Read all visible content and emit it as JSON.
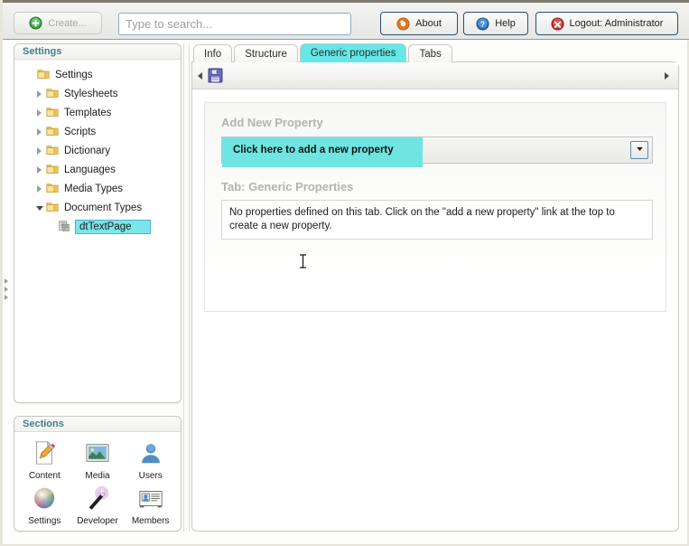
{
  "header": {
    "create_label": "Create...",
    "search_placeholder": "Type to search...",
    "search_value": "",
    "about_label": "About",
    "help_label": "Help",
    "logout_label": "Logout: Administrator",
    "icons": {
      "create": "green-plus-circle-icon",
      "about": "orange-refresh-circle-icon",
      "help": "blue-question-circle-icon",
      "logout": "red-x-circle-icon"
    }
  },
  "sidebar": {
    "tree_panel_title": "Settings",
    "tree": [
      {
        "label": "Settings",
        "level": 1,
        "state": "root",
        "icon": "folder-icon"
      },
      {
        "label": "Stylesheets",
        "level": 2,
        "state": "collapsed",
        "icon": "folder-icon"
      },
      {
        "label": "Templates",
        "level": 2,
        "state": "collapsed",
        "icon": "folder-icon"
      },
      {
        "label": "Scripts",
        "level": 2,
        "state": "collapsed",
        "icon": "folder-icon"
      },
      {
        "label": "Dictionary",
        "level": 2,
        "state": "collapsed",
        "icon": "folder-icon"
      },
      {
        "label": "Languages",
        "level": 2,
        "state": "collapsed",
        "icon": "folder-icon"
      },
      {
        "label": "Media Types",
        "level": 2,
        "state": "collapsed",
        "icon": "folder-icon"
      },
      {
        "label": "Document Types",
        "level": 2,
        "state": "expanded",
        "icon": "folder-icon"
      },
      {
        "label": "dtTextPage",
        "level": 3,
        "state": "selected",
        "icon": "document-type-icon"
      }
    ],
    "sections_panel_title": "Sections",
    "sections": [
      {
        "label": "Content",
        "icon": "page-pencil-icon"
      },
      {
        "label": "Media",
        "icon": "picture-frame-icon"
      },
      {
        "label": "Users",
        "icon": "user-silhouette-icon"
      },
      {
        "label": "Settings",
        "icon": "color-sphere-icon"
      },
      {
        "label": "Developer",
        "icon": "magic-wand-icon"
      },
      {
        "label": "Members",
        "icon": "member-card-icon"
      }
    ]
  },
  "main": {
    "tabs": [
      {
        "label": "Info",
        "active": false
      },
      {
        "label": "Structure",
        "active": false
      },
      {
        "label": "Generic properties",
        "active": true
      },
      {
        "label": "Tabs",
        "active": false
      }
    ],
    "toolbar": {
      "save_icon": "floppy-disk-save-icon",
      "scroll_left_icon": "triangle-left-icon",
      "scroll_right_icon": "triangle-right-icon"
    },
    "add_property": {
      "section_title": "Add New Property",
      "link_label": "Click here to add a new property",
      "dropdown_icon": "chevron-down-icon",
      "dropdown_value": ""
    },
    "tab_section": {
      "title": "Tab: Generic Properties",
      "empty_message": "No properties defined on this tab. Click on the \"add a new property\" link at the top to create a new property."
    }
  },
  "colors": {
    "accent_cyan": "#6fe5e1",
    "tab_active": "#66e6e6",
    "selection_cyan": "#79e7e8",
    "panel_title": "#3f7f8c",
    "muted_heading": "#b3b3b0"
  }
}
